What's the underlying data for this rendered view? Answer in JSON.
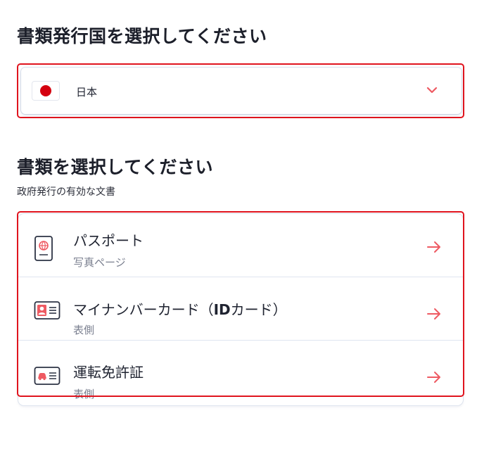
{
  "country_section": {
    "title": "書類発行国を選択してください",
    "selected_country": "日本",
    "flag_icon": "japan-flag-icon",
    "dropdown_icon": "chevron-down-icon"
  },
  "document_section": {
    "title": "書類を選択してください",
    "subtitle": "政府発行の有効な文書",
    "documents": [
      {
        "name": "パスポート",
        "side": "写真ページ",
        "icon": "passport-icon"
      },
      {
        "name_prefix": "マイナンバーカード（",
        "name_bold": "ID",
        "name_suffix": "カード）",
        "side": "表側",
        "icon": "id-card-icon"
      },
      {
        "name": "運転免許証",
        "side": "表側",
        "icon": "drivers-license-icon"
      }
    ]
  },
  "colors": {
    "highlight_border": "#e0141e",
    "accent_arrow": "#ee5a62",
    "flag_red": "#d4000f"
  }
}
